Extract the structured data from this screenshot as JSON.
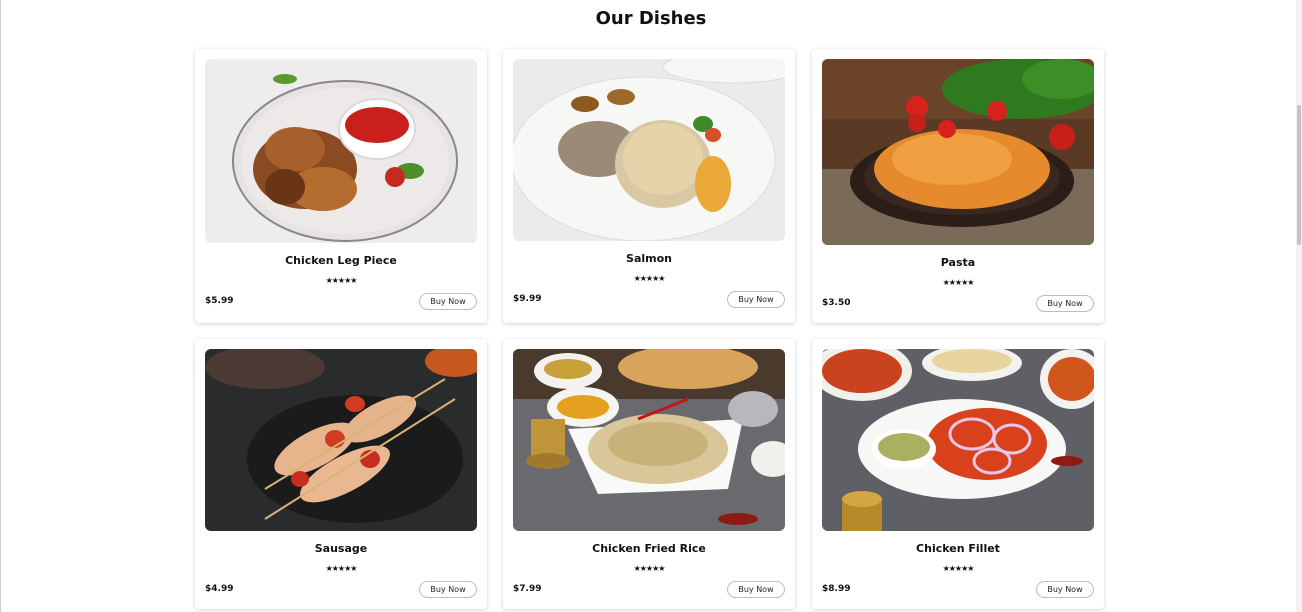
{
  "section_title": "Our Dishes",
  "dishes": [
    {
      "name": "Chicken Leg Piece",
      "price": "$5.99",
      "rating": "★★★★★",
      "button": "Buy Now"
    },
    {
      "name": "Salmon",
      "price": "$9.99",
      "rating": "★★★★★",
      "button": "Buy Now"
    },
    {
      "name": "Pasta",
      "price": "$3.50",
      "rating": "★★★★★",
      "button": "Buy Now"
    },
    {
      "name": "Sausage",
      "price": "$4.99",
      "rating": "★★★★★",
      "button": "Buy Now"
    },
    {
      "name": "Chicken Fried Rice",
      "price": "$7.99",
      "rating": "★★★★★",
      "button": "Buy Now"
    },
    {
      "name": "Chicken Fillet",
      "price": "$8.99",
      "rating": "★★★★★",
      "button": "Buy Now"
    }
  ]
}
